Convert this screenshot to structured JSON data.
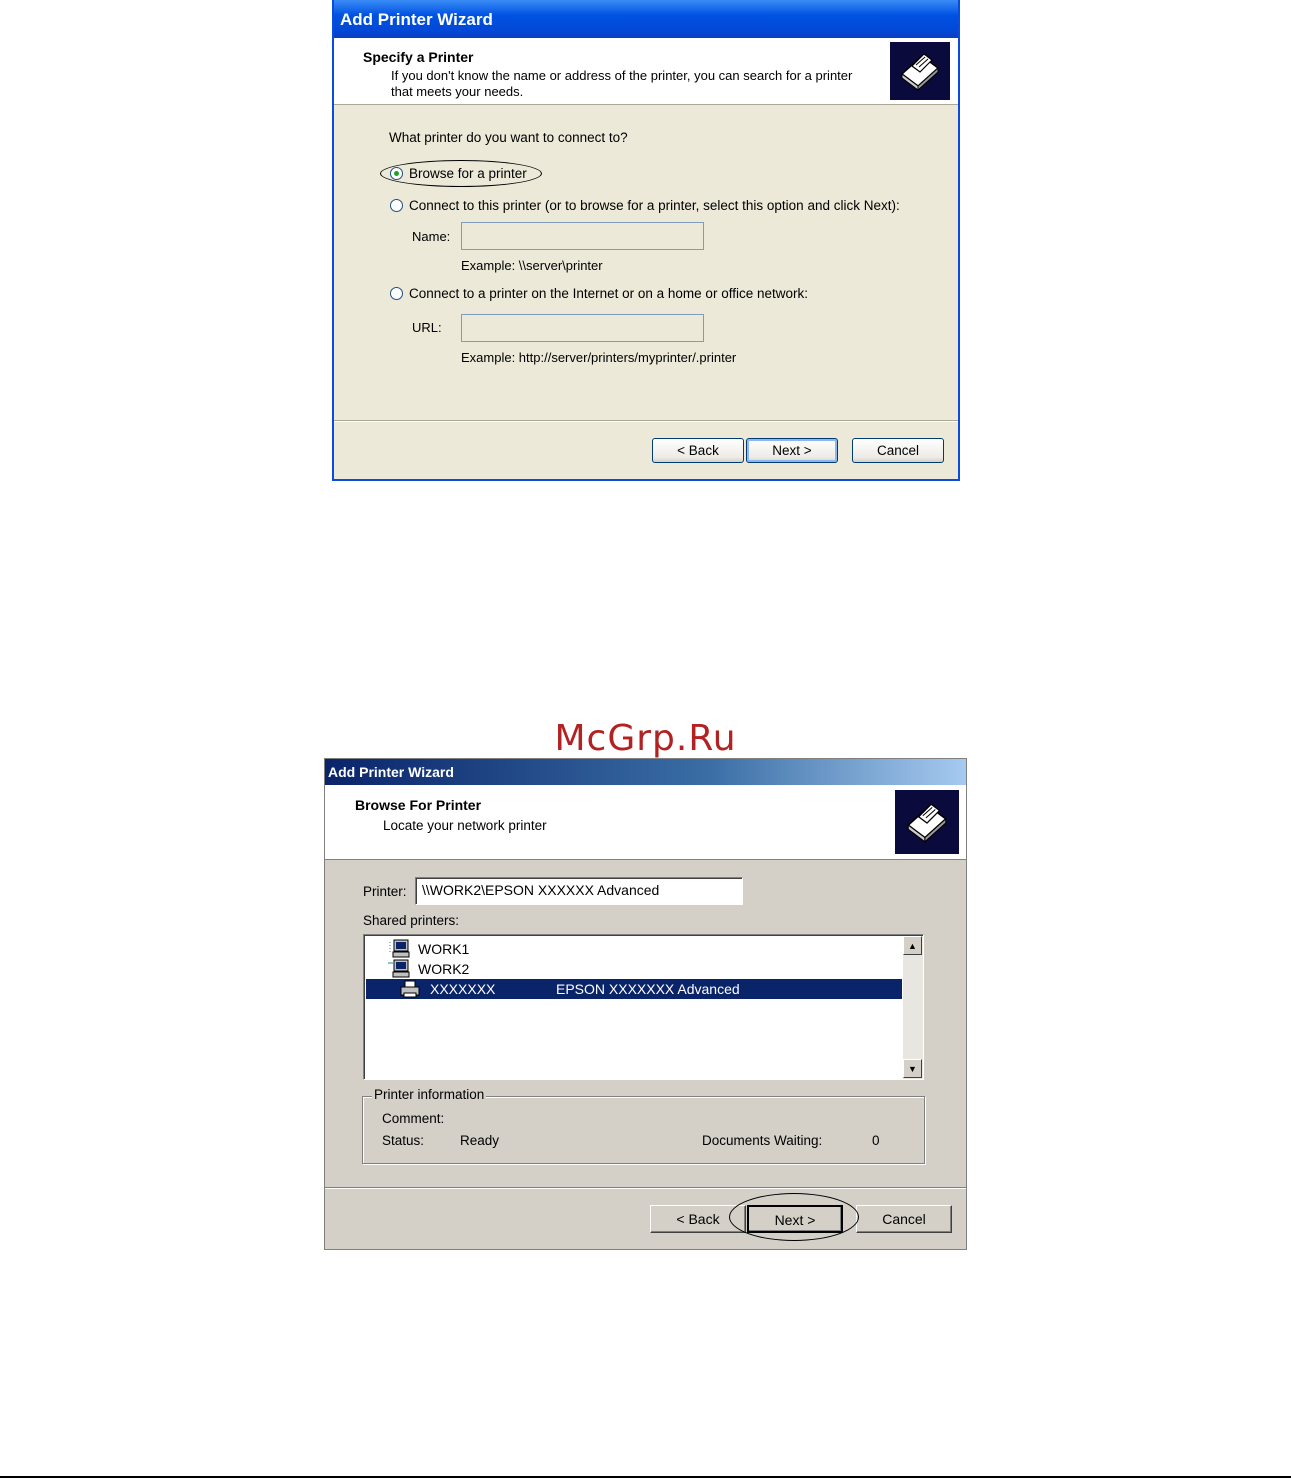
{
  "dialog1": {
    "title": "Add Printer Wizard",
    "header_title": "Specify a Printer",
    "header_subtitle_line1": "If you don't know the name or address of the printer, you can search for a printer",
    "header_subtitle_line2": "that meets your needs.",
    "question": "What printer do you want to connect to?",
    "options": [
      {
        "label": "Browse for a printer",
        "selected": true
      },
      {
        "label": "Connect to this printer (or to browse for a printer, select this option and click Next):",
        "selected": false
      },
      {
        "label": "Connect to a printer on the Internet or on a home or office network:",
        "selected": false
      }
    ],
    "name_label": "Name:",
    "name_value": "",
    "name_example": "Example: \\\\server\\printer",
    "url_label": "URL:",
    "url_value": "",
    "url_example": "Example: http://server/printers/myprinter/.printer",
    "buttons": {
      "back": "< Back",
      "next": "Next >",
      "cancel": "Cancel"
    },
    "icon": "printer-wizard-icon"
  },
  "watermark": "McGrp.Ru",
  "dialog2": {
    "title": "Add Printer Wizard",
    "header_title": "Browse For Printer",
    "header_subtitle": "Locate your network printer",
    "printer_label": "Printer:",
    "printer_value": "\\\\WORK2\\EPSON XXXXXX Advanced",
    "shared_label": "Shared printers:",
    "shared_items": [
      {
        "name": "WORK1",
        "detail": "",
        "icon": "computer-icon",
        "selected": false
      },
      {
        "name": "WORK2",
        "detail": "",
        "icon": "computer-icon",
        "selected": false
      },
      {
        "name": "XXXXXXX",
        "detail": "EPSON XXXXXXX Advanced",
        "icon": "printer-icon",
        "selected": true
      }
    ],
    "info_group": "Printer information",
    "comment_label": "Comment:",
    "comment_value": "",
    "status_label": "Status:",
    "status_value": "Ready",
    "docs_label": "Documents Waiting:",
    "docs_value": "0",
    "buttons": {
      "back": "< Back",
      "next": "Next >",
      "cancel": "Cancel"
    },
    "icon": "printer-wizard-icon"
  }
}
